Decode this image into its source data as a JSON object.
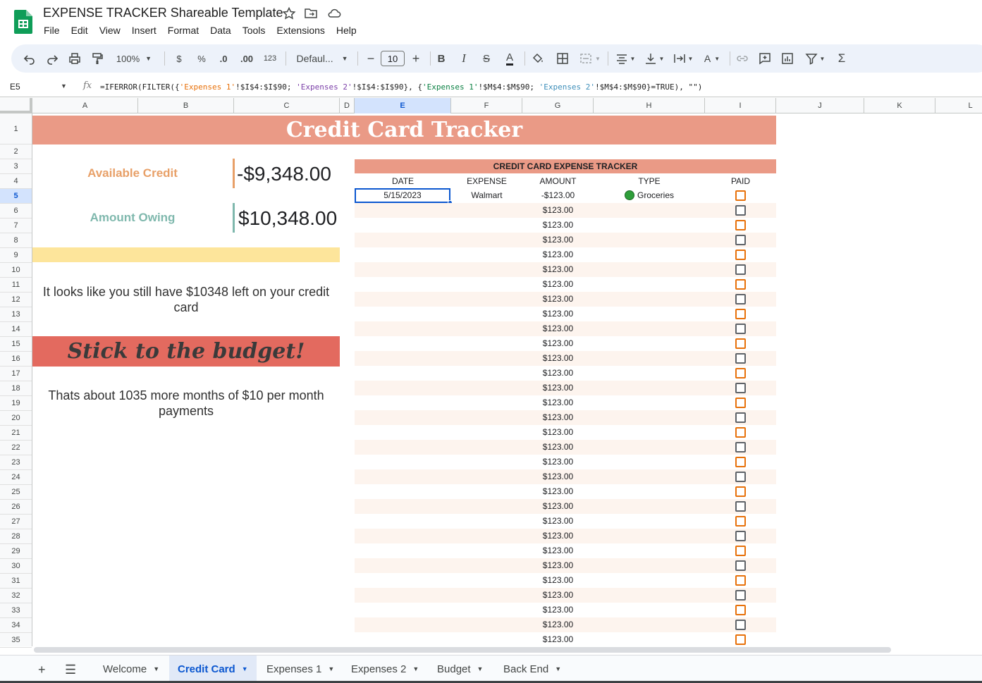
{
  "window": {
    "title": "EXPENSE TRACKER Shareable Template",
    "menu": [
      "File",
      "Edit",
      "View",
      "Insert",
      "Format",
      "Data",
      "Tools",
      "Extensions",
      "Help"
    ]
  },
  "toolbar": {
    "zoom": "100%",
    "currency": "$",
    "percent": "%",
    "decrease_decimals": ".0",
    "increase_decimals": ".00",
    "number_format": "123",
    "font_family": "Defaul...",
    "font_size": "10"
  },
  "formula_bar": {
    "cell_ref": "E5",
    "formula_parts": [
      "=IFERROR(FILTER({",
      "'Expenses 1'",
      "!$I$4:$I$90; ",
      "'Expenses 2'",
      "!$I$4:$I$90}, {",
      "'Expenses 1'",
      "!$M$4:$M$90; ",
      "'Expenses 2'",
      "!$M$4:$M$90}=TRUE), \"\")"
    ]
  },
  "grid": {
    "columns": [
      "A",
      "B",
      "C",
      "D",
      "E",
      "F",
      "G",
      "H",
      "I",
      "J",
      "K",
      "L"
    ],
    "selected_column": "E",
    "rows": [
      "1",
      "2",
      "3",
      "4",
      "5",
      "6",
      "7",
      "8",
      "9",
      "10",
      "11",
      "12",
      "13",
      "14",
      "15",
      "16",
      "17",
      "18",
      "19",
      "20",
      "21",
      "22",
      "23",
      "24",
      "25",
      "26",
      "27",
      "28",
      "29",
      "30",
      "31",
      "32",
      "33",
      "34",
      "35"
    ],
    "selected_row": "5"
  },
  "sheet": {
    "banner": "Credit Card Tracker",
    "available_credit_label": "Available Credit",
    "available_credit_value": "-$9,348.00",
    "amount_owing_label": "Amount Owing",
    "amount_owing_value": "$10,348.00",
    "message_remaining": "It looks like you still have $10348 left on your credit card",
    "budget_banner": "Stick to the budget!",
    "message_months": "Thats about 1035 more months of $10 per month payments"
  },
  "tracker": {
    "title": "CREDIT CARD EXPENSE TRACKER",
    "headers": {
      "date": "DATE",
      "expense": "EXPENSE",
      "amount": "AMOUNT",
      "type": "TYPE",
      "paid": "PAID"
    },
    "first_entry": {
      "date": "5/15/2023",
      "expense": "Walmart",
      "amount": "-$123.00",
      "type": "Groceries"
    },
    "amounts": [
      "$123.00",
      "$123.00",
      "$123.00",
      "$123.00",
      "$123.00",
      "$123.00",
      "$123.00",
      "$123.00",
      "$123.00",
      "$123.00",
      "$123.00",
      "$123.00",
      "$123.00",
      "$123.00",
      "$123.00",
      "$123.00",
      "$123.00",
      "$123.00",
      "$123.00",
      "$123.00",
      "$123.00",
      "$123.00",
      "$123.00",
      "$123.00",
      "$123.00",
      "$123.00",
      "$123.00",
      "$123.00",
      "$123.00",
      "$123.00"
    ]
  },
  "tabs": [
    "Welcome",
    "Credit Card",
    "Expenses 1",
    "Expenses 2",
    "Budget",
    "Back End"
  ],
  "active_tab": "Credit Card",
  "colors": {
    "banner": "#ea9a86",
    "available_credit": "#e8a068",
    "amount_owing": "#7fb8ad",
    "budget_banner": "#e36a5f",
    "highlight_band": "#fde59b",
    "selection": "#0b57d0"
  }
}
